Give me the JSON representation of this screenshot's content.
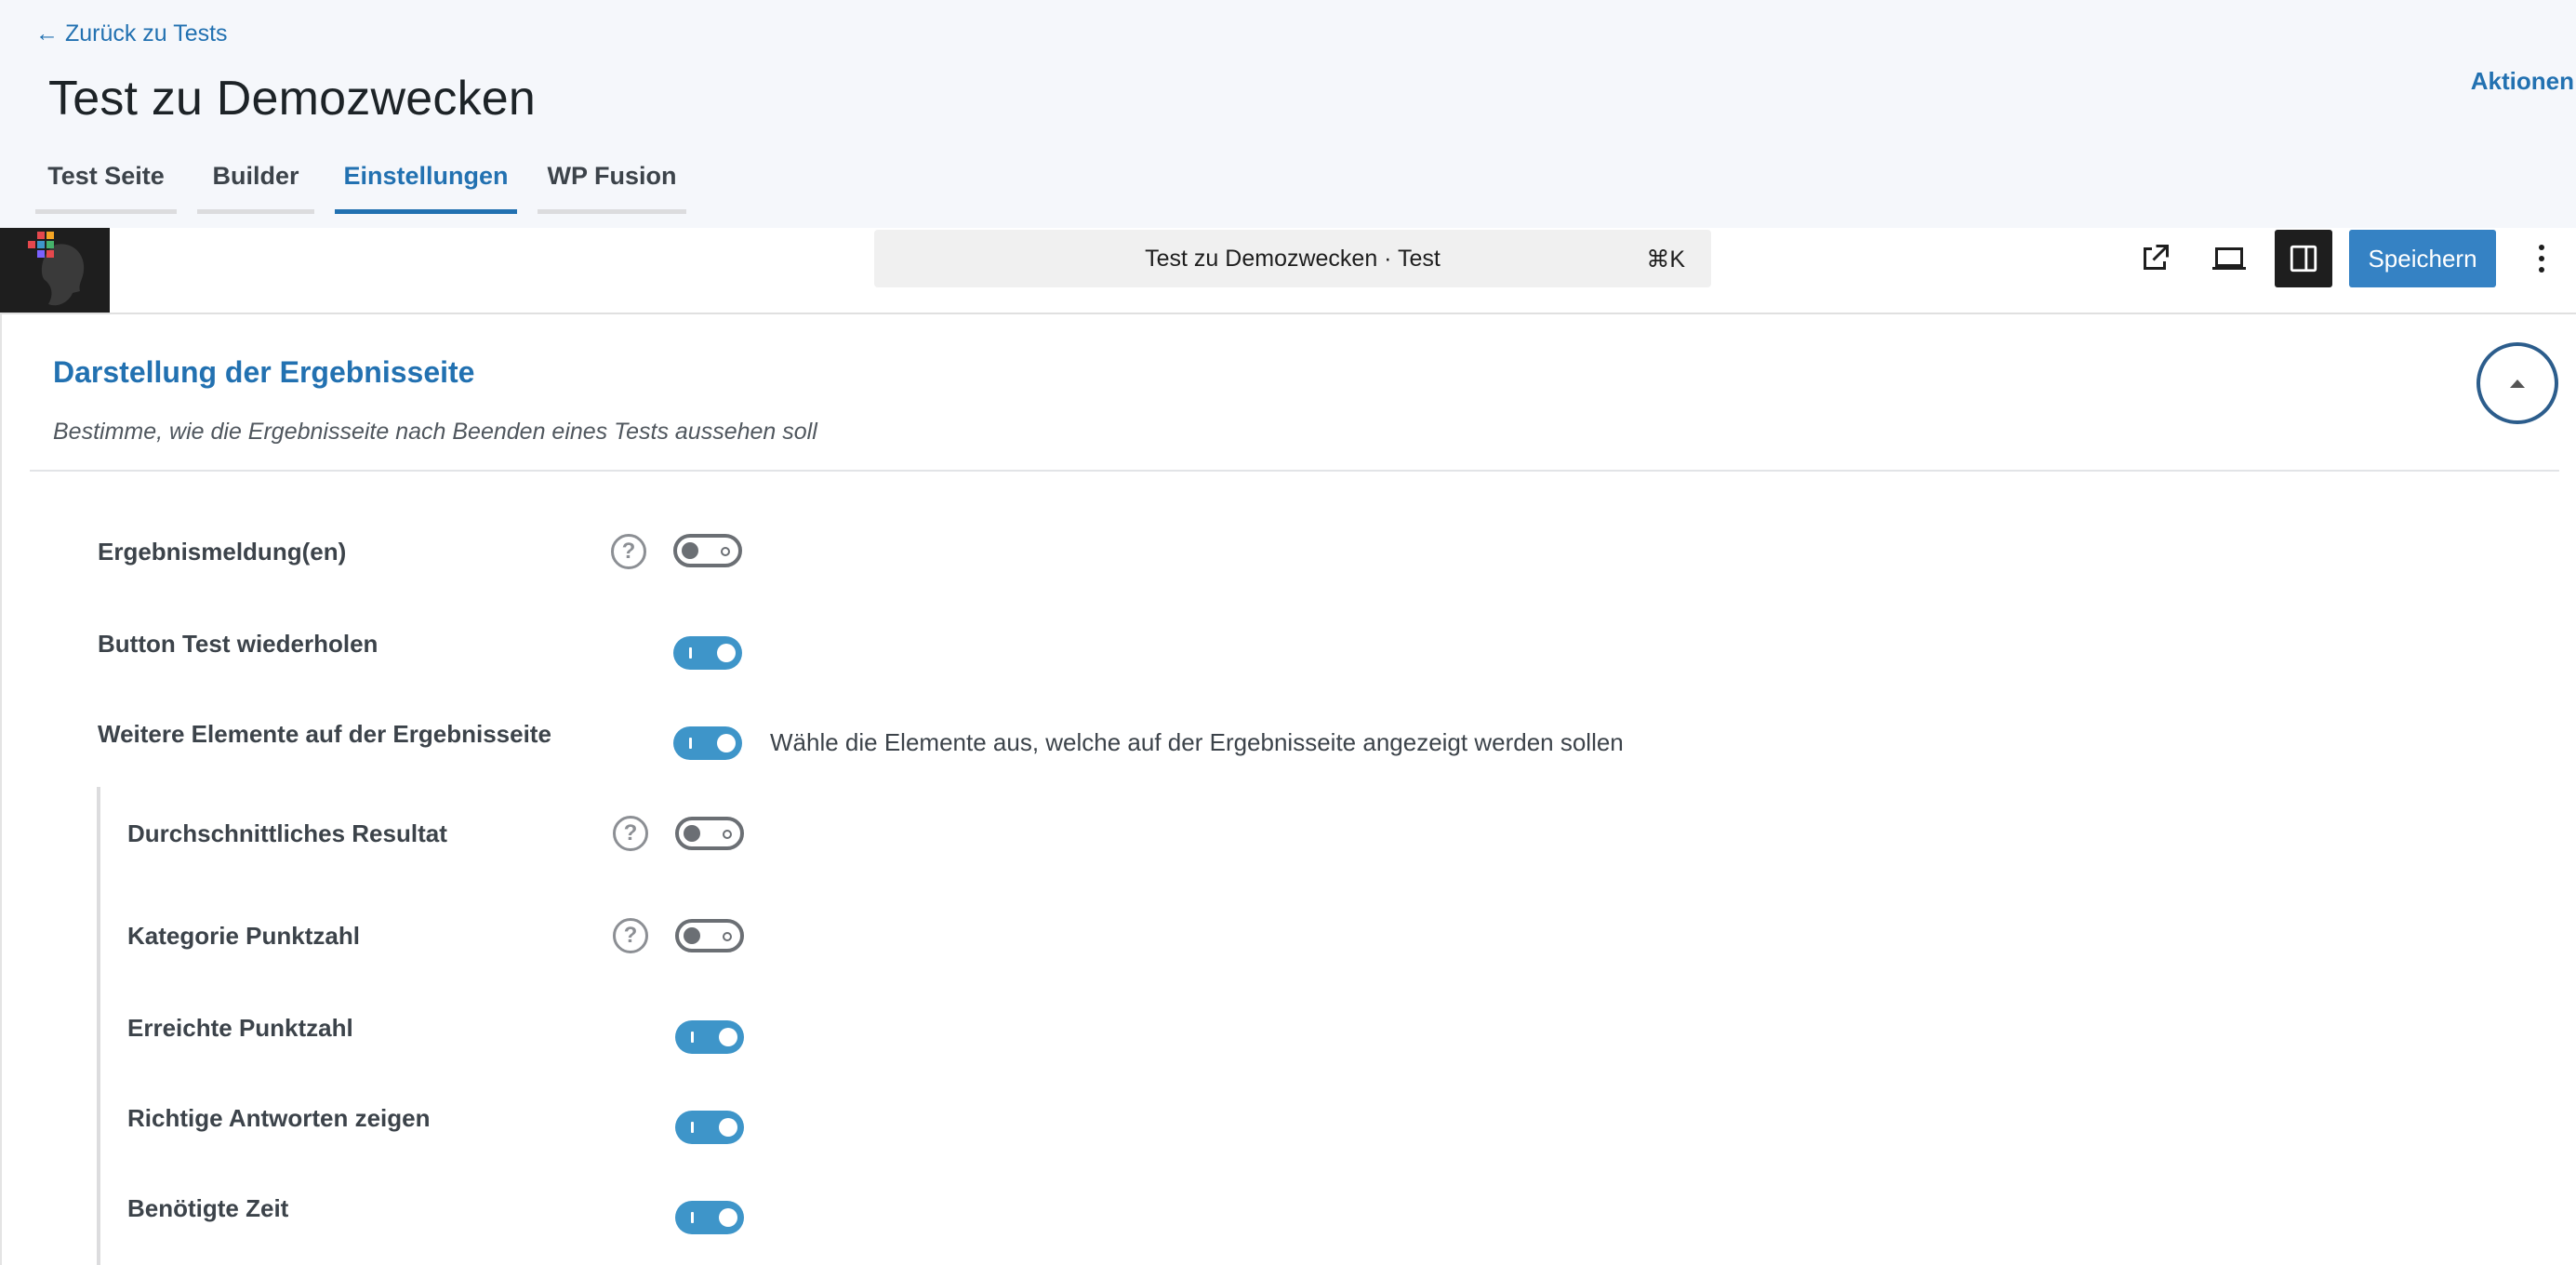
{
  "header": {
    "back_link": "← Zurück zu Tests",
    "title": "Test zu Demozwecken",
    "actions": "Aktionen",
    "tabs": [
      {
        "label": "Test Seite",
        "active": false
      },
      {
        "label": "Builder",
        "active": false
      },
      {
        "label": "Einstellungen",
        "active": true
      },
      {
        "label": "WP Fusion",
        "active": false
      }
    ]
  },
  "toolbar": {
    "command_bar_title": "Test zu Demozwecken · Test",
    "command_shortcut": "⌘K",
    "save_label": "Speichern",
    "icons": [
      "external-link-icon",
      "desktop-preview-icon",
      "sidebar-toggle-icon",
      "more-options-icon"
    ]
  },
  "section": {
    "title": "Darstellung der Ergebnisseite",
    "description": "Bestimme, wie die Ergebnisseite nach Beenden eines Tests aussehen soll",
    "settings": [
      {
        "label": "Ergebnismeldung(en)",
        "enabled": false,
        "help": true
      },
      {
        "label": "Button Test wiederholen",
        "enabled": true,
        "help": false
      },
      {
        "label": "Weitere Elemente auf der Ergebnisseite",
        "enabled": true,
        "help": false,
        "hint": "Wähle die Elemente aus, welche auf der Ergebnisseite angezeigt werden sollen"
      },
      {
        "label": "Durchschnittliches Resultat",
        "enabled": false,
        "help": true,
        "nested": true
      },
      {
        "label": "Kategorie Punktzahl",
        "enabled": false,
        "help": true,
        "nested": true
      },
      {
        "label": "Erreichte Punktzahl",
        "enabled": true,
        "help": false,
        "nested": true
      },
      {
        "label": "Richtige Antworten zeigen",
        "enabled": true,
        "help": false,
        "nested": true
      },
      {
        "label": "Benötigte Zeit",
        "enabled": true,
        "help": false,
        "nested": true
      }
    ],
    "help_glyph": "?"
  },
  "colors": {
    "accent": "#2271b1",
    "toggle_on": "#3e95c9",
    "save_button": "#3582c4"
  }
}
